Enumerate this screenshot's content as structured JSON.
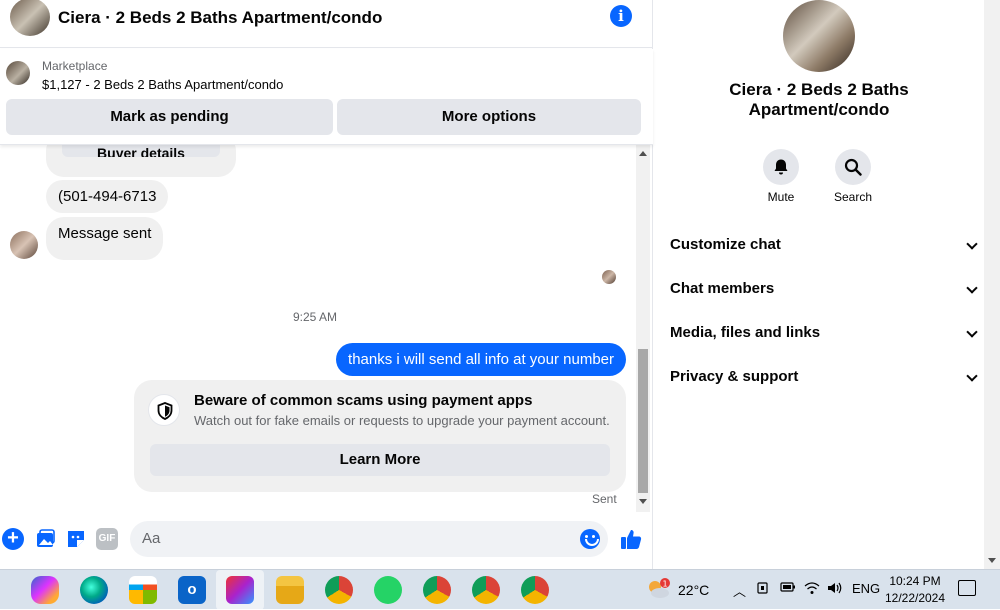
{
  "header": {
    "title": "Ciera · 2 Beds 2 Baths Apartment/condo"
  },
  "listing": {
    "label": "Marketplace",
    "price_line": "$1,127 - 2 Beds 2 Baths Apartment/condo",
    "buttons": {
      "pending": "Mark as pending",
      "more": "More options"
    }
  },
  "messages": {
    "partial_button": "Buyer details",
    "phone": "(501-494-6713",
    "status_msg": "Message sent",
    "timestamp": "9:25 AM",
    "my_message": "thanks i will send all info at your number",
    "scam": {
      "title": "Beware of common scams using payment apps",
      "desc": "Watch out for fake emails or requests to upgrade your payment account.",
      "button": "Learn More"
    },
    "delivery": "Sent"
  },
  "composer": {
    "placeholder": "Aa",
    "gif_label": "GIF"
  },
  "panel": {
    "name_line1": "Ciera · 2 Beds 2 Baths",
    "name_line2": "Apartment/condo",
    "actions": {
      "mute": "Mute",
      "search": "Search"
    },
    "sections": [
      "Customize chat",
      "Chat members",
      "Media, files and links",
      "Privacy & support"
    ]
  },
  "taskbar": {
    "temperature": "22°C",
    "language": "ENG",
    "time": "10:24 PM",
    "date": "12/22/2024",
    "weather_badge": "1"
  },
  "colors": {
    "accent": "#0866ff",
    "bubble": "#f0f0f0",
    "taskbar": "#d9e2ec"
  }
}
